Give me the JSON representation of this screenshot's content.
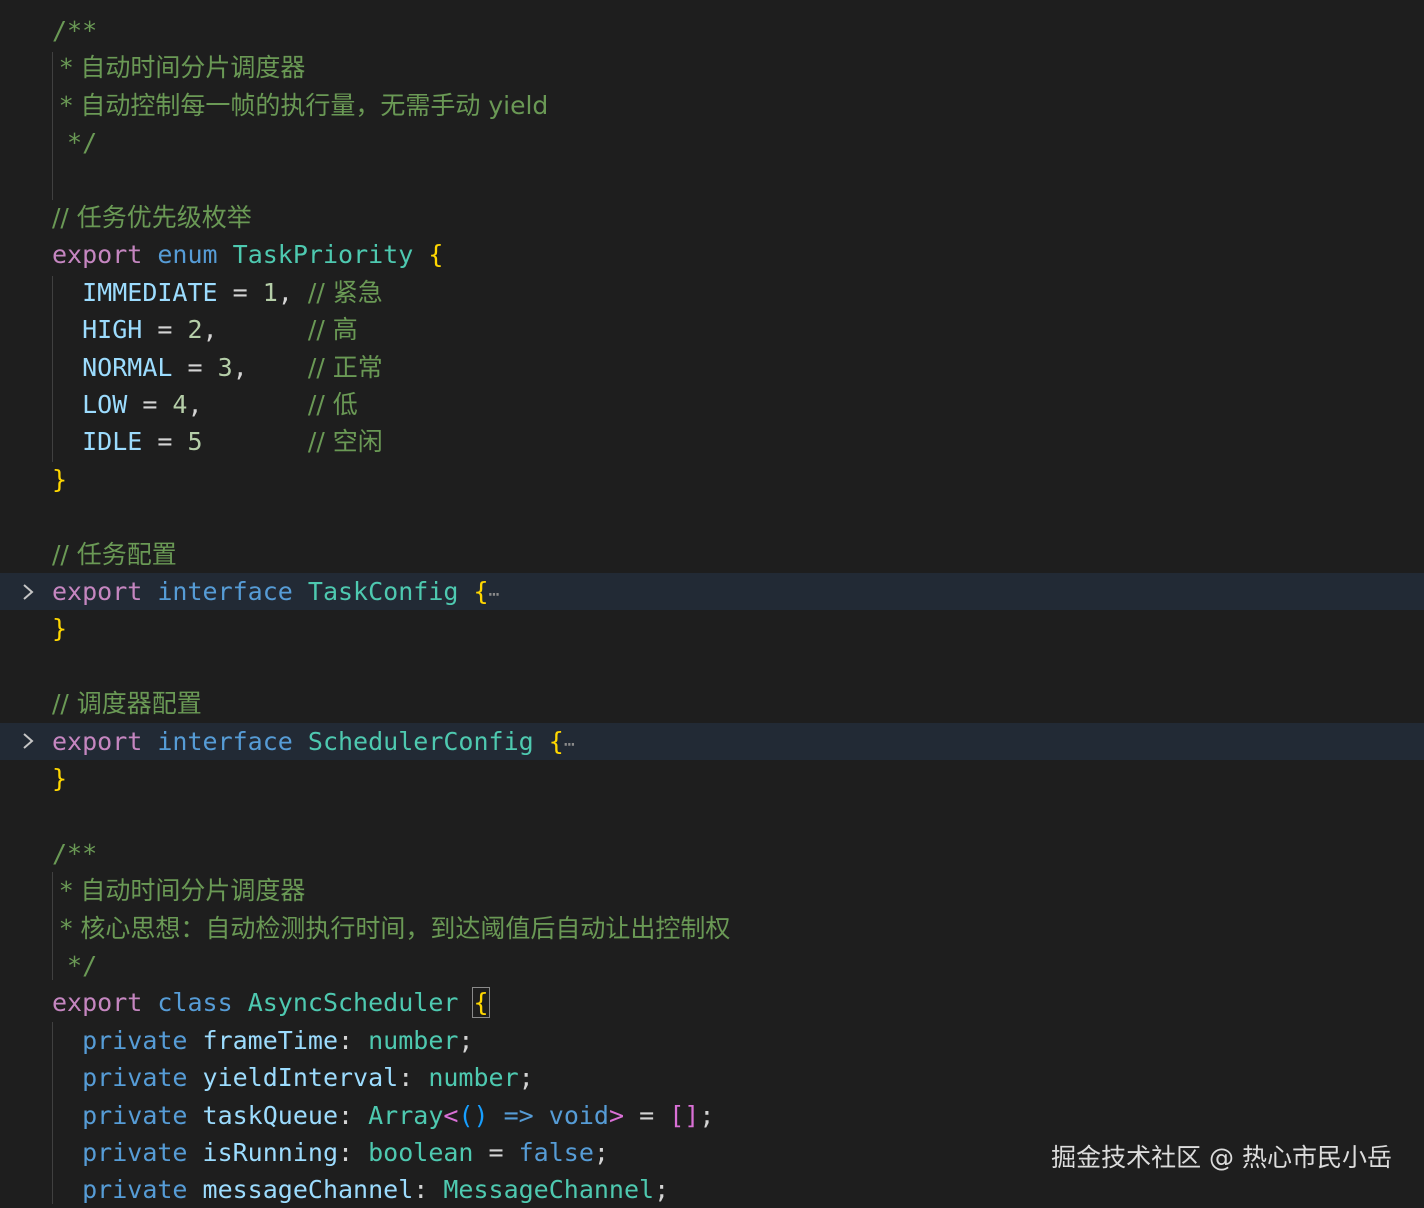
{
  "editor": {
    "lines": [
      {
        "tokens": [
          {
            "t": "/**",
            "c": "com"
          }
        ]
      },
      {
        "tokens": [
          {
            "t": " * 自动时间分片调度器",
            "c": "com"
          }
        ]
      },
      {
        "tokens": [
          {
            "t": " * 自动控制每一帧的执行量，无需手动 yield",
            "c": "com"
          }
        ]
      },
      {
        "tokens": [
          {
            "t": " */",
            "c": "com"
          }
        ]
      },
      {
        "tokens": []
      },
      {
        "tokens": [
          {
            "t": "// 任务优先级枚举",
            "c": "com"
          }
        ]
      },
      {
        "tokens": [
          {
            "t": "export",
            "c": "kw"
          },
          {
            "t": " "
          },
          {
            "t": "enum",
            "c": "kwb"
          },
          {
            "t": " "
          },
          {
            "t": "TaskPriority",
            "c": "type"
          },
          {
            "t": " "
          },
          {
            "t": "{",
            "c": "br1"
          }
        ]
      },
      {
        "tokens": [
          {
            "t": "  "
          },
          {
            "t": "IMMEDIATE",
            "c": "prop"
          },
          {
            "t": " = ",
            "c": "op"
          },
          {
            "t": "1",
            "c": "num"
          },
          {
            "t": ", ",
            "c": "op"
          },
          {
            "t": "// 紧急",
            "c": "com"
          }
        ]
      },
      {
        "tokens": [
          {
            "t": "  "
          },
          {
            "t": "HIGH",
            "c": "prop"
          },
          {
            "t": " = ",
            "c": "op"
          },
          {
            "t": "2",
            "c": "num"
          },
          {
            "t": ",      ",
            "c": "op"
          },
          {
            "t": "// 高",
            "c": "com"
          }
        ]
      },
      {
        "tokens": [
          {
            "t": "  "
          },
          {
            "t": "NORMAL",
            "c": "prop"
          },
          {
            "t": " = ",
            "c": "op"
          },
          {
            "t": "3",
            "c": "num"
          },
          {
            "t": ",    ",
            "c": "op"
          },
          {
            "t": "// 正常",
            "c": "com"
          }
        ]
      },
      {
        "tokens": [
          {
            "t": "  "
          },
          {
            "t": "LOW",
            "c": "prop"
          },
          {
            "t": " = ",
            "c": "op"
          },
          {
            "t": "4",
            "c": "num"
          },
          {
            "t": ",       ",
            "c": "op"
          },
          {
            "t": "// 低",
            "c": "com"
          }
        ]
      },
      {
        "tokens": [
          {
            "t": "  "
          },
          {
            "t": "IDLE",
            "c": "prop"
          },
          {
            "t": " = ",
            "c": "op"
          },
          {
            "t": "5",
            "c": "num"
          },
          {
            "t": "       ",
            "c": "op"
          },
          {
            "t": "// 空闲",
            "c": "com"
          }
        ]
      },
      {
        "tokens": [
          {
            "t": "}",
            "c": "br1"
          }
        ]
      },
      {
        "tokens": []
      },
      {
        "tokens": [
          {
            "t": "// 任务配置",
            "c": "com"
          }
        ]
      },
      {
        "fold": true,
        "highlight": true,
        "tokens": [
          {
            "t": "export",
            "c": "kw"
          },
          {
            "t": " "
          },
          {
            "t": "interface",
            "c": "kwb"
          },
          {
            "t": " "
          },
          {
            "t": "TaskConfig",
            "c": "type"
          },
          {
            "t": " "
          },
          {
            "t": "{",
            "c": "br1"
          },
          {
            "t": "⋯",
            "c": "ellipsis"
          }
        ]
      },
      {
        "tokens": [
          {
            "t": "}",
            "c": "br1"
          }
        ]
      },
      {
        "tokens": []
      },
      {
        "tokens": [
          {
            "t": "// 调度器配置",
            "c": "com"
          }
        ]
      },
      {
        "fold": true,
        "highlight": true,
        "tokens": [
          {
            "t": "export",
            "c": "kw"
          },
          {
            "t": " "
          },
          {
            "t": "interface",
            "c": "kwb"
          },
          {
            "t": " "
          },
          {
            "t": "SchedulerConfig",
            "c": "type"
          },
          {
            "t": " "
          },
          {
            "t": "{",
            "c": "br1"
          },
          {
            "t": "⋯",
            "c": "ellipsis"
          }
        ]
      },
      {
        "tokens": [
          {
            "t": "}",
            "c": "br1"
          }
        ]
      },
      {
        "tokens": []
      },
      {
        "tokens": [
          {
            "t": "/**",
            "c": "com"
          }
        ]
      },
      {
        "tokens": [
          {
            "t": " * 自动时间分片调度器",
            "c": "com"
          }
        ]
      },
      {
        "tokens": [
          {
            "t": " * 核心思想：自动检测执行时间，到达阈值后自动让出控制权",
            "c": "com"
          }
        ]
      },
      {
        "tokens": [
          {
            "t": " */",
            "c": "com"
          }
        ]
      },
      {
        "tokens": [
          {
            "t": "export",
            "c": "kw"
          },
          {
            "t": " "
          },
          {
            "t": "class",
            "c": "kwb"
          },
          {
            "t": " "
          },
          {
            "t": "AsyncScheduler",
            "c": "type"
          },
          {
            "t": " "
          },
          {
            "t": "{",
            "c": "br1",
            "cursor": true
          }
        ]
      },
      {
        "tokens": [
          {
            "t": "  "
          },
          {
            "t": "private",
            "c": "kwb"
          },
          {
            "t": " "
          },
          {
            "t": "frameTime",
            "c": "prop"
          },
          {
            "t": ": ",
            "c": "op"
          },
          {
            "t": "number",
            "c": "type"
          },
          {
            "t": ";",
            "c": "op"
          }
        ]
      },
      {
        "tokens": [
          {
            "t": "  "
          },
          {
            "t": "private",
            "c": "kwb"
          },
          {
            "t": " "
          },
          {
            "t": "yieldInterval",
            "c": "prop"
          },
          {
            "t": ": ",
            "c": "op"
          },
          {
            "t": "number",
            "c": "type"
          },
          {
            "t": ";",
            "c": "op"
          }
        ]
      },
      {
        "tokens": [
          {
            "t": "  "
          },
          {
            "t": "private",
            "c": "kwb"
          },
          {
            "t": " "
          },
          {
            "t": "taskQueue",
            "c": "prop"
          },
          {
            "t": ": ",
            "c": "op"
          },
          {
            "t": "Array",
            "c": "type"
          },
          {
            "t": "<",
            "c": "br2"
          },
          {
            "t": "()",
            "c": "br3"
          },
          {
            "t": " "
          },
          {
            "t": "=>",
            "c": "kwb"
          },
          {
            "t": " "
          },
          {
            "t": "void",
            "c": "kwb"
          },
          {
            "t": ">",
            "c": "br2"
          },
          {
            "t": " = ",
            "c": "op"
          },
          {
            "t": "[]",
            "c": "br2"
          },
          {
            "t": ";",
            "c": "op"
          }
        ]
      },
      {
        "tokens": [
          {
            "t": "  "
          },
          {
            "t": "private",
            "c": "kwb"
          },
          {
            "t": " "
          },
          {
            "t": "isRunning",
            "c": "prop"
          },
          {
            "t": ": ",
            "c": "op"
          },
          {
            "t": "boolean",
            "c": "type"
          },
          {
            "t": " = ",
            "c": "op"
          },
          {
            "t": "false",
            "c": "kwb"
          },
          {
            "t": ";",
            "c": "op"
          }
        ]
      },
      {
        "tokens": [
          {
            "t": "  "
          },
          {
            "t": "private",
            "c": "kwb"
          },
          {
            "t": " "
          },
          {
            "t": "messageChannel",
            "c": "prop"
          },
          {
            "t": ": ",
            "c": "op"
          },
          {
            "t": "MessageChannel",
            "c": "type"
          },
          {
            "t": ";",
            "c": "op"
          }
        ]
      }
    ]
  },
  "watermark": {
    "text": "掘金技术社区 @ 热心市民小岳"
  },
  "colors": {
    "background": "#1e1e1e",
    "comment": "#6a9955",
    "keyword_control": "#c586c0",
    "keyword": "#569cd6",
    "type": "#4ec9b0",
    "property": "#9cdcfe",
    "number": "#b5cea8",
    "bracket_level1": "#ffd700",
    "bracket_level2": "#da70d6",
    "bracket_level3": "#179fff",
    "fold_highlight": "#222a35"
  },
  "icons": {
    "fold": "chevron-right-icon"
  }
}
